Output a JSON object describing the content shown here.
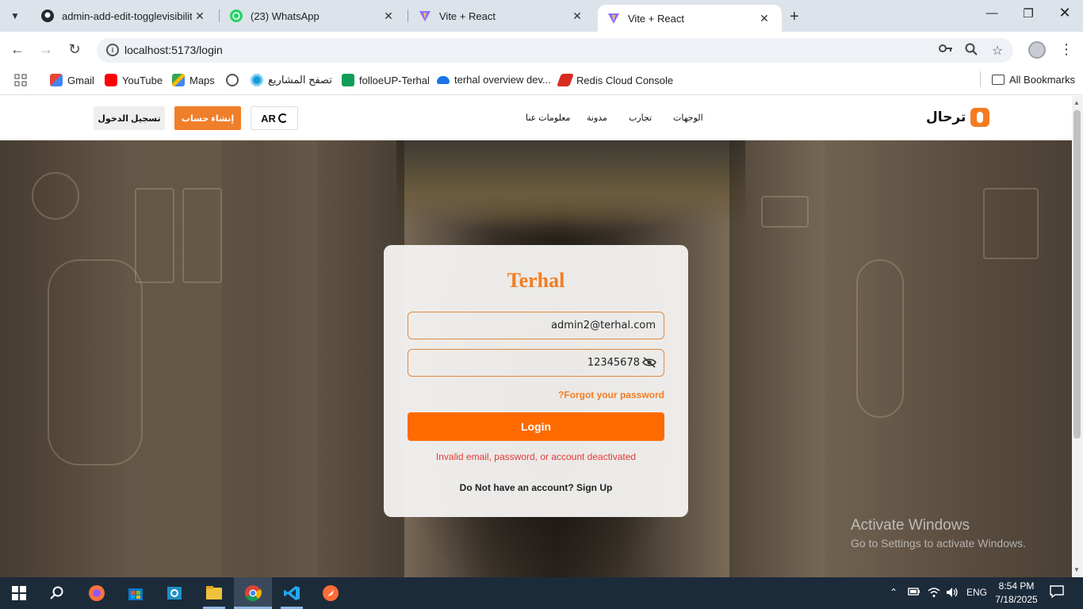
{
  "browser": {
    "tabs": [
      {
        "title": "admin-add-edit-togglevisibility",
        "favicon": "github-icon",
        "active": false
      },
      {
        "title": "(23) WhatsApp",
        "favicon": "whatsapp-icon",
        "active": false
      },
      {
        "title": "Vite + React",
        "favicon": "vite-icon",
        "active": false
      },
      {
        "title": "Vite + React",
        "favicon": "vite-icon",
        "active": true
      }
    ],
    "url": "localhost:5173/login",
    "bookmarks": [
      {
        "label": "Gmail",
        "icon": "gmail-icon",
        "color": "#ea4335"
      },
      {
        "label": "YouTube",
        "icon": "youtube-icon",
        "color": "#ff0000"
      },
      {
        "label": "Maps",
        "icon": "maps-icon",
        "color": "#34a853"
      },
      {
        "label": "",
        "icon": "globe-icon",
        "color": "#555555"
      },
      {
        "label": "تصفح المشاريع",
        "icon": "circle-icon",
        "color": "#1a9bd7"
      },
      {
        "label": "folloeUP-Terhal",
        "icon": "sheets-icon",
        "color": "#0f9d58"
      },
      {
        "label": "terhal overview dev...",
        "icon": "cloud-icon",
        "color": "#1a73e8"
      },
      {
        "label": "Redis Cloud Console",
        "icon": "redis-icon",
        "color": "#d82c20"
      }
    ],
    "all_bookmarks": "All Bookmarks"
  },
  "site": {
    "header": {
      "signin_label": "تسجيل الدخول",
      "signup_label": "إنشاء حساب",
      "lang_label": "AR",
      "nav": [
        "معلومات عنا",
        "مدونة",
        "تجارب",
        "الوجهات"
      ],
      "logo_text": "ترحال"
    },
    "login": {
      "title": "Terhal",
      "email_value": "admin2@terhal.com",
      "password_value": "12345678",
      "forgot": "?Forgot your password",
      "button": "Login",
      "error": "Invalid email, password, or account deactivated",
      "signup_prompt": "Do Not have an account? Sign Up"
    },
    "accent": "#f47c20"
  },
  "windows": {
    "watermark_title": "Activate Windows",
    "watermark_sub": "Go to Settings to activate Windows.",
    "tray_lang": "ENG",
    "time": "8:54 PM",
    "date": "7/18/2025"
  }
}
